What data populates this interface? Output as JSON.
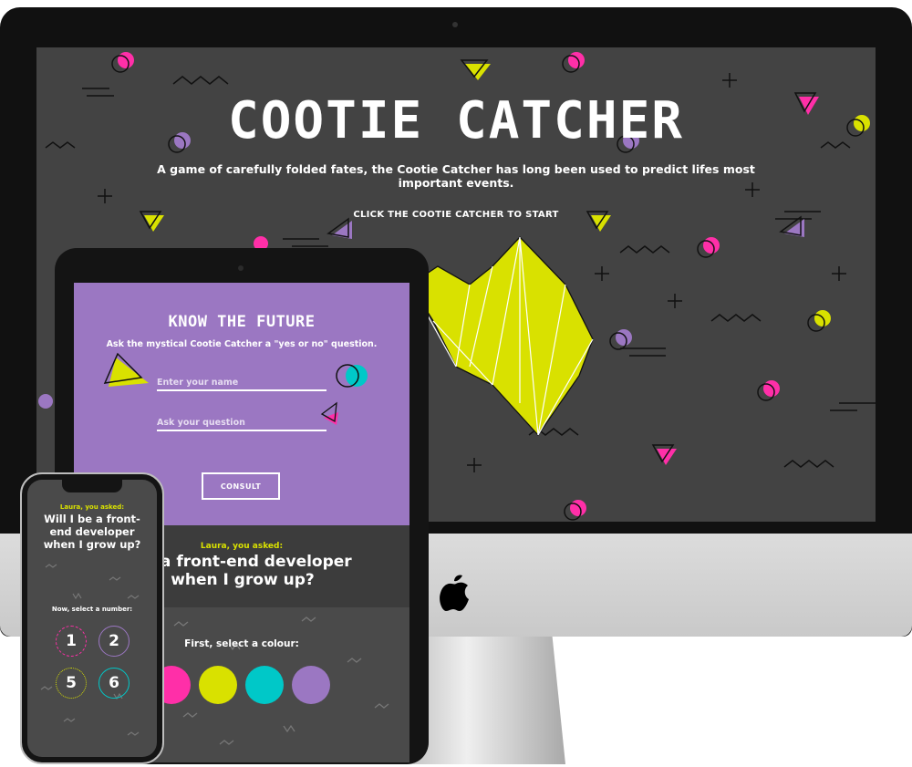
{
  "desktop": {
    "title": "COOTIE CATCHER",
    "subtitle": "A game of carefully folded fates, the Cootie Catcher has long been used to predict lifes most important events.",
    "cta": "CLICK THE COOTIE CATCHER TO START"
  },
  "tablet": {
    "heading": "KNOW THE FUTURE",
    "instruction": "Ask the mystical Cootie Catcher a \"yes or no\" question.",
    "name_placeholder": "Enter your name",
    "question_placeholder": "Ask your question",
    "consult_label": "CONSULT",
    "asked_label": "Laura, you asked:",
    "asked_question": "be a front-end developer when I grow up?",
    "colour_prompt": "First, select a colour:"
  },
  "phone": {
    "asked_label": "Laura, you asked:",
    "asked_question": "Will I be a front-end developer when I grow up?",
    "number_prompt": "Now, select a number:",
    "numbers": [
      "1",
      "2",
      "5",
      "6"
    ]
  },
  "colors": {
    "pink": "#ff2fa8",
    "lime": "#d9e100",
    "cyan": "#00c8c8",
    "purple": "#9b77c2",
    "dark": "#434343"
  },
  "icons": [
    "apple-logo-icon",
    "camera-icon"
  ]
}
